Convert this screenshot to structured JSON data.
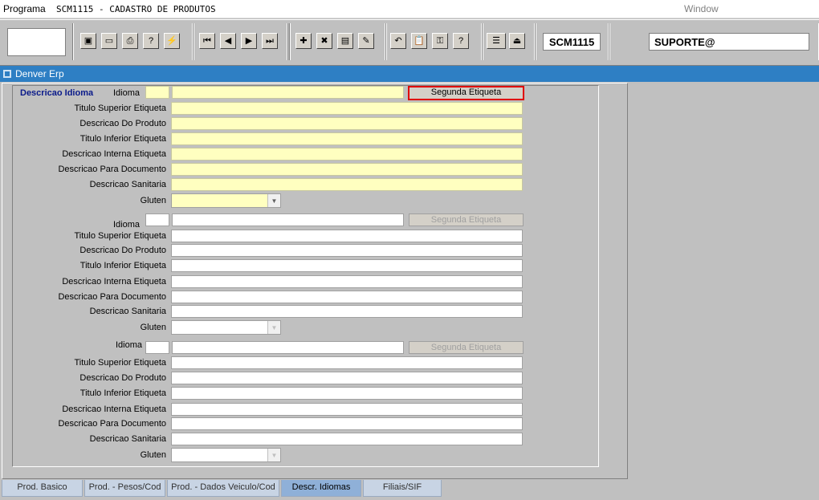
{
  "menubar": {
    "program": "Programa",
    "title": "SCM1115 - CADASTRO DE PRODUTOS",
    "window": "Window"
  },
  "toolbar": {
    "module_code": "SCM1115",
    "user": "SUPORTE@"
  },
  "appbar": {
    "title": "Denver Erp"
  },
  "section": {
    "title": "Descricao Idioma"
  },
  "labels": {
    "idioma": "Idioma",
    "titulo_superior": "Titulo Superior Etiqueta",
    "descricao_produto": "Descricao Do Produto",
    "titulo_inferior": "Titulo Inferior Etiqueta",
    "descricao_interna": "Descricao Interna Etiqueta",
    "descricao_documento": "Descricao Para Documento",
    "descricao_sanitaria": "Descricao Sanitaria",
    "gluten": "Gluten",
    "segunda_etiqueta": "Segunda Etiqueta"
  },
  "tabs": [
    {
      "label": "Prod. Basico"
    },
    {
      "label": "Prod. - Pesos/Cod"
    },
    {
      "label": "Prod. - Dados Veiculo/Cod"
    },
    {
      "label": "Descr. Idiomas",
      "selected": true
    },
    {
      "label": "Filiais/SIF"
    }
  ]
}
